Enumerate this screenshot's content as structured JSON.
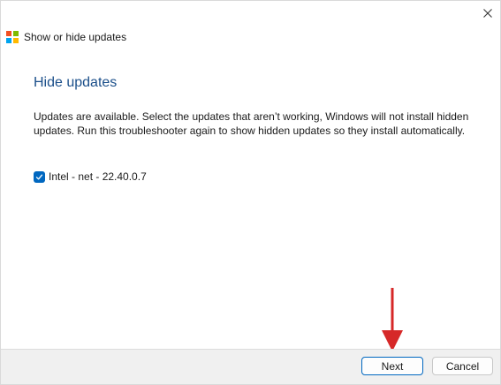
{
  "window": {
    "title": "Show or hide updates",
    "close_icon": "close-icon",
    "logo_icon": "windows-logo-icon",
    "logo_colors": [
      "#f25022",
      "#7fba00",
      "#00a4ef",
      "#ffb900"
    ]
  },
  "content": {
    "heading": "Hide updates",
    "description": "Updates are available. Select the updates that aren’t working, Windows will not install hidden updates. Run this troubleshooter again to show hidden updates so they install automatically.",
    "updates": [
      {
        "label": "Intel - net - 22.40.0.7",
        "checked": true
      }
    ]
  },
  "footer": {
    "next_label": "Next",
    "cancel_label": "Cancel"
  },
  "colors": {
    "heading": "#1b4f8a",
    "accent": "#0067c0",
    "annotation_arrow": "#d62828"
  }
}
